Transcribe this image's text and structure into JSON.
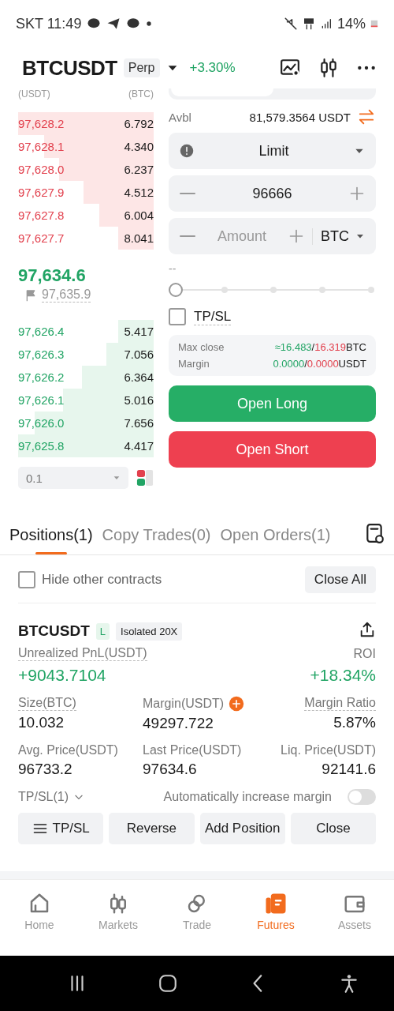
{
  "status_bar": {
    "carrier_time": "SKT 11:49",
    "battery": "14%"
  },
  "header": {
    "symbol": "BTCUSDT",
    "badge": "Perp",
    "change": "+3.30%"
  },
  "order_book": {
    "price_header": "(USDT)",
    "size_header": "(BTC)",
    "asks": [
      {
        "price": "97,628.2",
        "size": "6.792"
      },
      {
        "price": "97,628.1",
        "size": "4.340"
      },
      {
        "price": "97,628.0",
        "size": "6.237"
      },
      {
        "price": "97,627.9",
        "size": "4.512"
      },
      {
        "price": "97,627.8",
        "size": "6.004"
      },
      {
        "price": "97,627.7",
        "size": "8.041"
      }
    ],
    "last_price": "97,634.6",
    "mark_price": "97,635.9",
    "bids": [
      {
        "price": "97,626.4",
        "size": "5.417"
      },
      {
        "price": "97,626.3",
        "size": "7.056"
      },
      {
        "price": "97,626.2",
        "size": "6.364"
      },
      {
        "price": "97,626.1",
        "size": "5.016"
      },
      {
        "price": "97,626.0",
        "size": "7.656"
      },
      {
        "price": "97,625.8",
        "size": "4.417"
      }
    ],
    "depth": "0.1"
  },
  "order_form": {
    "avbl_label": "Avbl",
    "avbl_value": "81,579.3564 USDT",
    "order_type": "Limit",
    "price": "96666",
    "amount_placeholder": "Amount",
    "amount_unit": "BTC",
    "estimate": "--",
    "slider": {
      "level": 0
    },
    "tpsl": {
      "label": "TP/SL",
      "checked": false
    },
    "info": [
      {
        "label": "Max close",
        "long": "≈16.483",
        "separator": "/",
        "short": "16.319",
        "unit": "BTC"
      },
      {
        "label": "Margin",
        "long": "0.0000",
        "separator": "/",
        "short": "0.0000",
        "unit": "USDT"
      }
    ],
    "buttons": [
      {
        "label": "Open Long",
        "kind": "long"
      },
      {
        "label": "Open Short",
        "kind": "short"
      }
    ]
  },
  "tabs": [
    {
      "label": "Positions(1)",
      "selected": true
    },
    {
      "label": "Copy Trades(0)",
      "selected": false
    },
    {
      "label": "Open Orders(1)",
      "selected": false
    }
  ],
  "filter": {
    "label": "Hide other contracts",
    "checked": false,
    "action": "Close All"
  },
  "position": {
    "symbol": "BTCUSDT",
    "side": "L",
    "mode": "Isolated 20X",
    "pnl_label": "Unrealized PnL(USDT)",
    "roi_label": "ROI",
    "pnl": "+9043.7104",
    "roi": "+18.34%",
    "stats": [
      {
        "label": "Size(BTC)",
        "value": "10.032"
      },
      {
        "label": "Margin(USDT)",
        "value": "49297.722",
        "kind": "add"
      },
      {
        "label": "Margin Ratio",
        "value": "5.87%"
      },
      {
        "label": "Avg. Price(USDT)",
        "value": "96733.2"
      },
      {
        "label": "Last Price(USDT)",
        "value": "97634.6"
      },
      {
        "label": "Liq. Price(USDT)",
        "value": "92141.6"
      }
    ],
    "tpsl": "TP/SL(1)",
    "auto_margin": {
      "label": "Automatically increase margin",
      "on": false
    },
    "actions": [
      {
        "label": "TP/SL",
        "kind": "menu"
      },
      {
        "label": "Reverse",
        "kind": "plain"
      },
      {
        "label": "Add Position",
        "kind": "plain"
      },
      {
        "label": "Close",
        "kind": "plain"
      }
    ]
  },
  "nav": [
    {
      "label": "Home",
      "selected": false
    },
    {
      "label": "Markets",
      "selected": false
    },
    {
      "label": "Trade",
      "selected": false
    },
    {
      "label": "Futures",
      "selected": true
    },
    {
      "label": "Assets",
      "selected": false
    }
  ]
}
